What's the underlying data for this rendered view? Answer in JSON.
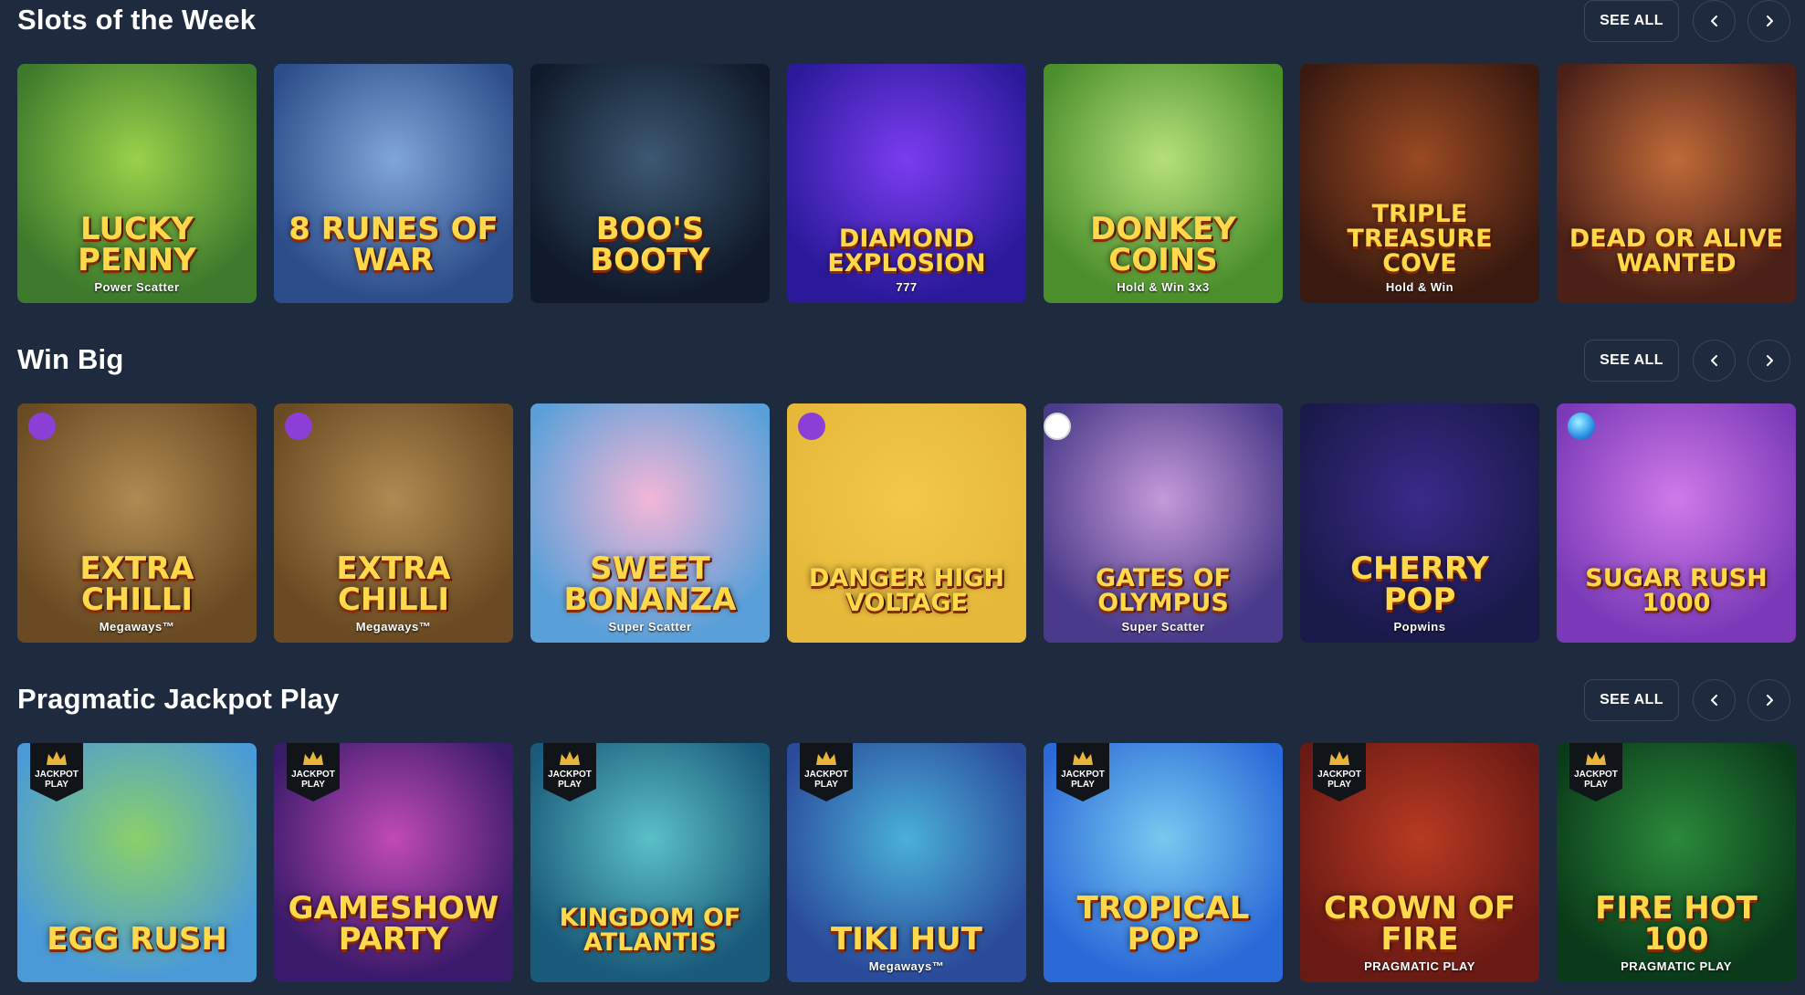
{
  "sections": [
    {
      "title": "Slots of the Week",
      "see_all_label": "SEE ALL",
      "games": [
        {
          "title": "Lucky Penny",
          "subtitle": "Power Scatter",
          "bg": "#3d7a2c",
          "bg2": "#9ad14a"
        },
        {
          "title": "8 Runes of War",
          "subtitle": "",
          "bg": "#2c4d8a",
          "bg2": "#7fa6d9"
        },
        {
          "title": "Boo's Booty",
          "subtitle": "",
          "bg": "#101a2a",
          "bg2": "#3c5872"
        },
        {
          "title": "Diamond Explosion",
          "subtitle": "777",
          "bg": "#2a1a9a",
          "bg2": "#7b3cf0"
        },
        {
          "title": "Donkey Coins",
          "subtitle": "Hold & Win 3x3",
          "bg": "#4a8f2a",
          "bg2": "#b5e07c"
        },
        {
          "title": "Triple Treasure Cove",
          "subtitle": "Hold & Win",
          "bg": "#3a1a10",
          "bg2": "#9a4a22"
        },
        {
          "title": "Dead or Alive Wanted",
          "subtitle": "",
          "bg": "#4a2018",
          "bg2": "#c06a38"
        }
      ]
    },
    {
      "title": "Win Big",
      "see_all_label": "SEE ALL",
      "games": [
        {
          "title": "Extra Chilli",
          "subtitle": "Megaways™",
          "bg": "#6a4a22",
          "bg2": "#b08a52",
          "badge": "purple"
        },
        {
          "title": "Extra Chilli",
          "subtitle": "Megaways™",
          "bg": "#6a4a22",
          "bg2": "#b08a52",
          "badge": "purple"
        },
        {
          "title": "Sweet Bonanza",
          "subtitle": "Super Scatter",
          "bg": "#5aa0d8",
          "bg2": "#f4b6d8"
        },
        {
          "title": "Danger High Voltage",
          "subtitle": "",
          "bg": "#e6b83a",
          "bg2": "#f2c94a",
          "badge": "purple"
        },
        {
          "title": "Gates of Olympus",
          "subtitle": "Super Scatter",
          "bg": "#4a3a8a",
          "bg2": "#c59ad8",
          "badge": "white"
        },
        {
          "title": "Cherry Pop",
          "subtitle": "Popwins",
          "bg": "#1a1a4a",
          "bg2": "#3a2a8a"
        },
        {
          "title": "Sugar Rush 1000",
          "subtitle": "",
          "bg": "#7a3ab8",
          "bg2": "#d07ae8",
          "badge": "gem"
        }
      ]
    },
    {
      "title": "Pragmatic Jackpot Play",
      "see_all_label": "SEE ALL",
      "jackpot_label_top": "JACKPOT",
      "jackpot_label_bottom": "PLAY",
      "games": [
        {
          "title": "Egg Rush",
          "subtitle": "",
          "bg": "#4a9ad8",
          "bg2": "#8ad06a"
        },
        {
          "title": "Gameshow Party",
          "subtitle": "",
          "bg": "#3a1a6a",
          "bg2": "#c04ab8"
        },
        {
          "title": "Kingdom of Atlantis",
          "subtitle": "",
          "bg": "#1a5a7a",
          "bg2": "#5ac0c8"
        },
        {
          "title": "Tiki Hut",
          "subtitle": "Megaways™",
          "bg": "#2a4a9a",
          "bg2": "#4ab0d8"
        },
        {
          "title": "Tropical Pop",
          "subtitle": "",
          "bg": "#2a6ad8",
          "bg2": "#7ac8f0"
        },
        {
          "title": "Crown of Fire",
          "subtitle": "PRAGMATIC PLAY",
          "bg": "#6a1a14",
          "bg2": "#b83a22"
        },
        {
          "title": "Fire Hot 100",
          "subtitle": "PRAGMATIC PLAY",
          "bg": "#0a3a1a",
          "bg2": "#2a8a3a"
        }
      ]
    }
  ],
  "icons": {
    "prev": "chevron-left-icon",
    "next": "chevron-right-icon",
    "jackpot_badge": "crown-icon"
  }
}
